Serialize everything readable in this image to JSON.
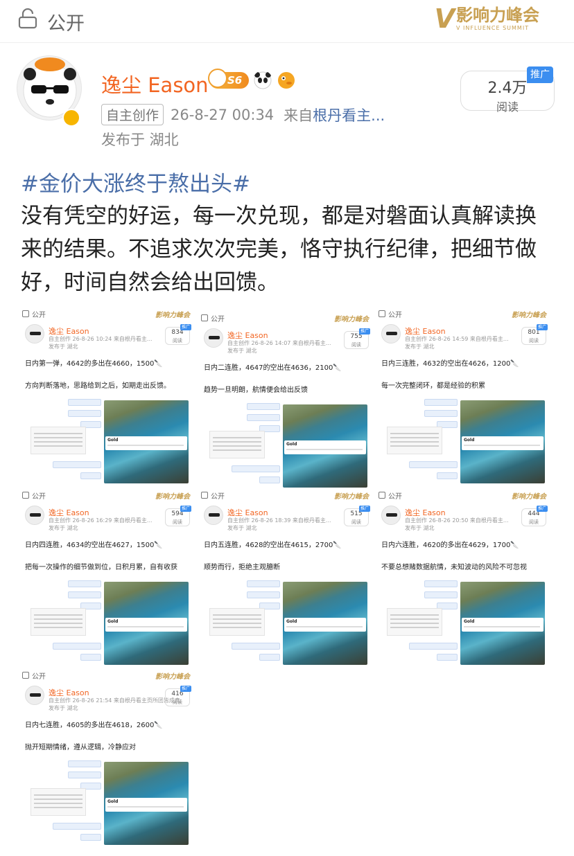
{
  "topbar": {
    "visibility": "公开"
  },
  "watermark": {
    "mark": "V",
    "cn": "影响力峰会",
    "en": "V INFLUENCE SUMMIT"
  },
  "author": {
    "name": "逸尘 Eason",
    "level_badge": "S6",
    "tag": "自主创作",
    "datetime": "26-8-27 00:34",
    "source_prefix": "来自",
    "source": "根丹看主...",
    "location": "发布于 湖北"
  },
  "stats": {
    "reads": "2.4万",
    "reads_label": "阅读",
    "promo": "推广"
  },
  "post": {
    "hashtag": "#金价大涨终于熬出头#",
    "text": "没有凭空的好运，每一次兑现，都是对磐面认真解读换来的结果。不追求次次完美，恪守执行纪律，把细节做好，时间自然会给出回馈。"
  },
  "tiles": [
    {
      "open": "公开",
      "wm": "影响力峰会",
      "name": "逸尘 Eason",
      "tag": "自主创作",
      "datetime": "26-8-26 10:24",
      "source": "来自根丹看主...",
      "location": "发布于 湖北",
      "reads": "834",
      "reads_label": "阅读",
      "promo": "推广",
      "line1": "日内第一弹，4642的多出在4660，1500🔪",
      "line2": "方向判断落地，思路给到之后，如期走出反馈。"
    },
    {
      "open": "公开",
      "wm": "影响力峰会",
      "name": "逸尘 Eason",
      "tag": "自主创作",
      "datetime": "26-8-26 14:07",
      "source": "来自根丹看主...",
      "location": "发布于 湖北",
      "reads": "755",
      "reads_label": "阅读",
      "promo": "推广",
      "line1": "日内二连胜，4647的空出在4636，2100🔪",
      "line2": "趋势一旦明朗，航情便会给出反馈"
    },
    {
      "open": "公开",
      "wm": "影响力峰会",
      "name": "逸尘 Eason",
      "tag": "自主创作",
      "datetime": "26-8-26 14:59",
      "source": "来自根丹看主...",
      "location": "发布于 湖北",
      "reads": "801",
      "reads_label": "阅读",
      "promo": "推广",
      "line1": "日内三连胜，4632的空出在4626，1200🔪",
      "line2": "每一次完整闭环，都是经验的积累"
    },
    {
      "open": "公开",
      "wm": "影响力峰会",
      "name": "逸尘 Eason",
      "tag": "自主创作",
      "datetime": "26-8-26 16:29",
      "source": "来自根丹看主...",
      "location": "发布于 湖北",
      "reads": "594",
      "reads_label": "阅读",
      "promo": "推广",
      "line1": "日内四连胜，4634的空出在4627，1500🔪",
      "line2": "把每一次操作的细节做到位，日积月累，自有收获"
    },
    {
      "open": "公开",
      "wm": "影响力峰会",
      "name": "逸尘 Eason",
      "tag": "自主创作",
      "datetime": "26-8-26 18:39",
      "source": "来自根丹看主...",
      "location": "发布于 湖北",
      "reads": "515",
      "reads_label": "阅读",
      "promo": "推广",
      "line1": "日内五连胜，4628的空出在4615，2700🔪",
      "line2": "顺势而行，拒绝主观臆断"
    },
    {
      "open": "公开",
      "wm": "影响力峰会",
      "name": "逸尘 Eason",
      "tag": "自主创作",
      "datetime": "26-8-26 20:50",
      "source": "来自根丹看主...",
      "location": "发布于 湖北",
      "reads": "444",
      "reads_label": "阅读",
      "promo": "推广",
      "line1": "日内六连胜，4620的多出在4629，1700🔪",
      "line2": "不要总想赌数据航情，未知波动的风险不可忽视"
    },
    {
      "open": "公开",
      "wm": "影响力峰会",
      "name": "逸尘 Eason",
      "tag": "自主创作",
      "datetime": "26-8-26 21:54",
      "source": "来自根丹看主页所团皆成真",
      "location": "发布于 湖北",
      "reads": "416",
      "reads_label": "阅读",
      "promo": "推广",
      "line1": "日内七连胜，4605的多出在4618，2600🔪",
      "line2": "抛开短期情绪，遵从逻辑，冷静应对"
    }
  ],
  "colors": {
    "username": "#f26522",
    "link": "#4a6ea8",
    "promo": "#3b8ef0",
    "gold": "#c8a052"
  }
}
